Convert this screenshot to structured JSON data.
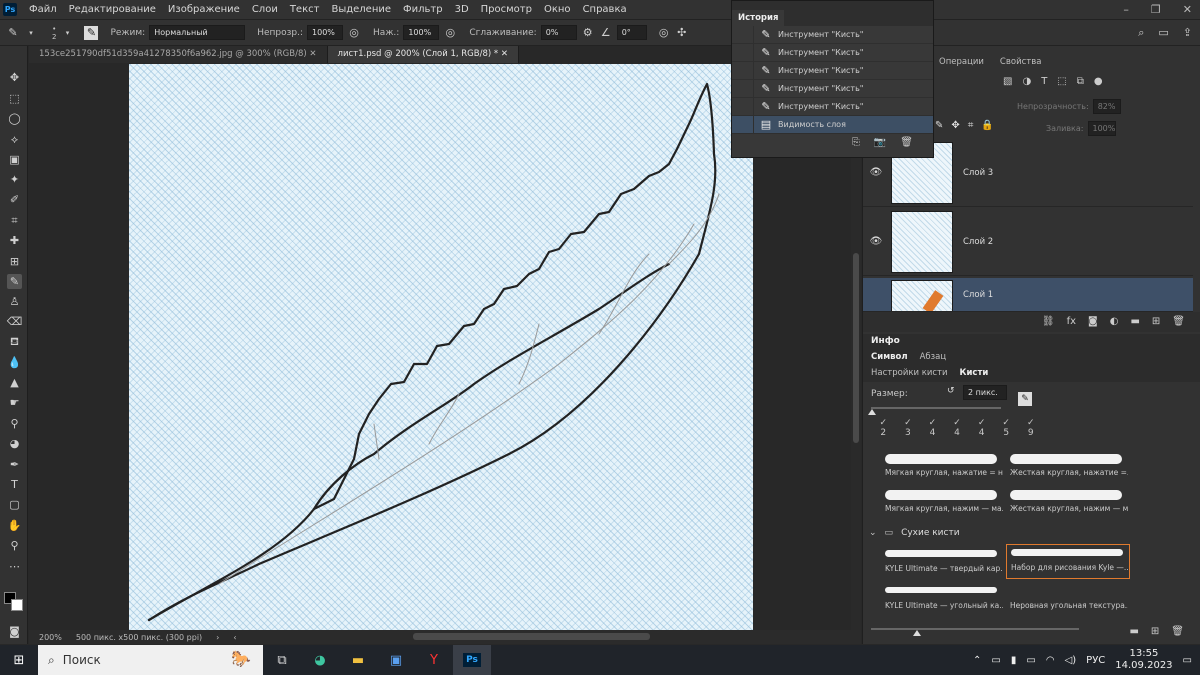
{
  "menu": {
    "app_icon": "Ps",
    "items": [
      "Файл",
      "Редактирование",
      "Изображение",
      "Слои",
      "Текст",
      "Выделение",
      "Фильтр",
      "3D",
      "Просмотр",
      "Окно",
      "Справка"
    ]
  },
  "options": {
    "brush_size": "2",
    "mode_label": "Режим:",
    "mode_value": "Нормальный",
    "opacity_label": "Непрозр.:",
    "opacity_value": "100%",
    "pressure_label": "Наж.:",
    "pressure_value": "100%",
    "smoothing_label": "Сглаживание:",
    "smoothing_value": "0%",
    "angle_value": "0°"
  },
  "tabs": [
    {
      "label": "153ce251790df51d359a41278350f6a962.jpg @ 300% (RGB/8)"
    },
    {
      "label": "лист1.psd @ 200% (Слой 1, RGB/8) *"
    }
  ],
  "status": {
    "zoom": "200%",
    "doc": "500 пикс. x500 пикс. (300 ppi)"
  },
  "history": {
    "title": "История",
    "items": [
      "Инструмент \"Кисть\"",
      "Инструмент \"Кисть\"",
      "Инструмент \"Кисть\"",
      "Инструмент \"Кисть\"",
      "Инструмент \"Кисть\"",
      "Видимость слоя"
    ]
  },
  "layers_panel": {
    "tabs": [
      "Операции",
      "Свойства"
    ],
    "opacity_label": "Непрозрачность:",
    "opacity_value": "82%",
    "fill_label": "Заливка:",
    "fill_value": "100%",
    "layers": [
      "Слой 3",
      "Слой 2",
      "Слой 1"
    ]
  },
  "info_panel": {
    "tab": "Инфо",
    "tabs2": [
      "Символ",
      "Абзац"
    ],
    "tabs3": [
      "Настройки кисти",
      "Кисти"
    ]
  },
  "brushes": {
    "size_label": "Размер:",
    "size_value": "2 пикс.",
    "presets": [
      "2",
      "3",
      "4",
      "4",
      "4",
      "5",
      "9"
    ],
    "folder": "Сухие кисти",
    "cells": [
      "Мягкая круглая, нажатие = н...",
      "Жесткая круглая, нажатие =...",
      "Мягкая круглая, нажим — ма...",
      "Жесткая круглая, нажим — м...",
      "KYLE Ultimate — твердый кар...",
      "Набор для рисования Kyle —...",
      "KYLE Ultimate — угольный ка...",
      "Неровная угольная текстура..."
    ]
  },
  "taskbar": {
    "search": "Поиск",
    "lang": "РУС",
    "time": "13:55",
    "date": "14.09.2023"
  },
  "colors": {
    "accent": "#e07a2e",
    "selection": "#3e5068"
  }
}
